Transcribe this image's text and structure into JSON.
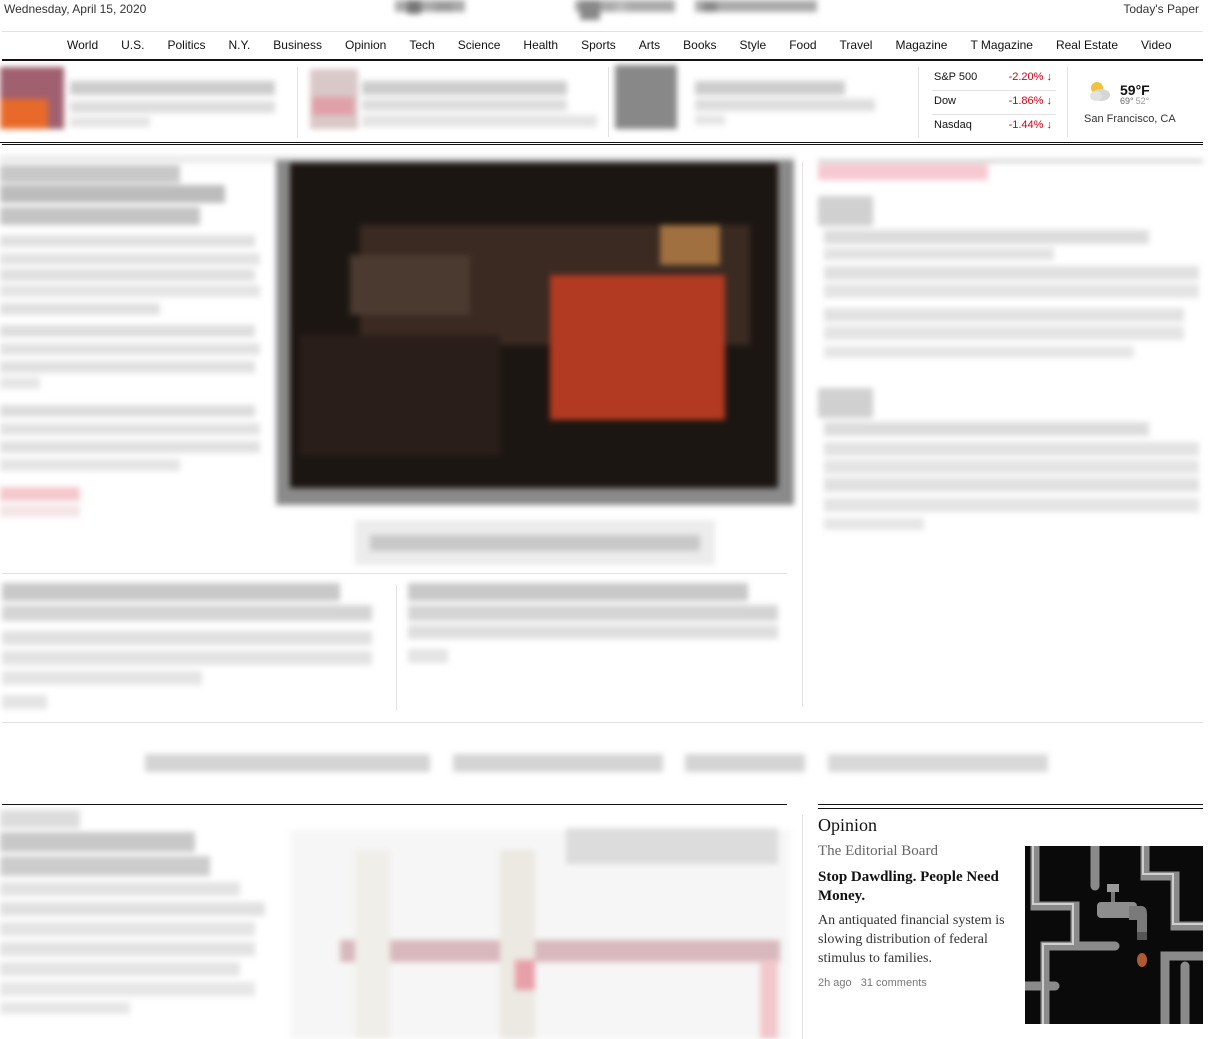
{
  "header": {
    "date": "Wednesday, April 15, 2020",
    "todays_paper": "Today's Paper"
  },
  "nav": {
    "items": [
      "World",
      "U.S.",
      "Politics",
      "N.Y.",
      "Business",
      "Opinion",
      "Tech",
      "Science",
      "Health",
      "Sports",
      "Arts",
      "Books",
      "Style",
      "Food",
      "Travel",
      "Magazine",
      "T Magazine",
      "Real Estate",
      "Video"
    ]
  },
  "markets": [
    {
      "name": "S&P 500",
      "change": "-2.20%"
    },
    {
      "name": "Dow",
      "change": "-1.86%"
    },
    {
      "name": "Nasdaq",
      "change": "-1.44%"
    }
  ],
  "weather": {
    "temp": "59°F",
    "high": "69°",
    "low": "52°",
    "location": "San Francisco, CA",
    "icon": "partly-cloudy-icon"
  },
  "opinion": {
    "section": "Opinion",
    "author": "The Editorial Board",
    "headline": "Stop Dawdling. People Need Money.",
    "summary": "An antiquated financial system is slowing distribution of federal stimulus to families.",
    "time": "2h ago",
    "comments": "31 comments"
  },
  "colors": {
    "down": "#d0021b",
    "rule": "#121212",
    "light_rule": "#e2e2e2"
  }
}
